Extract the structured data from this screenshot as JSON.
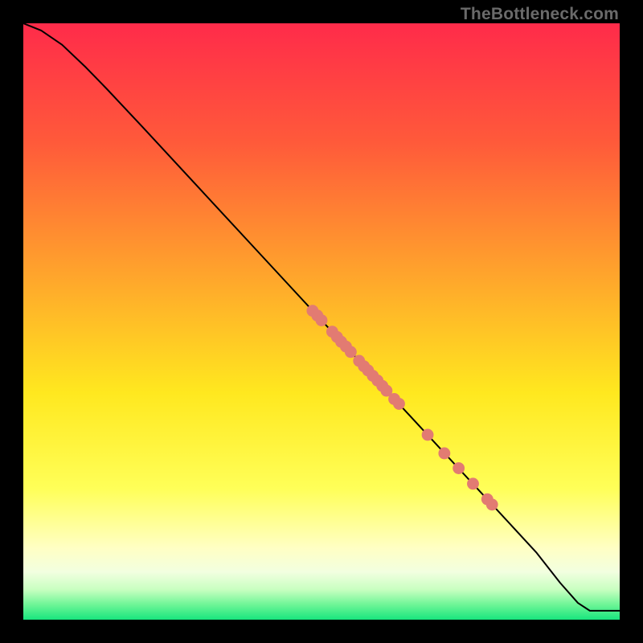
{
  "watermark": "TheBottleneck.com",
  "chart_data": {
    "type": "line",
    "title": "",
    "xlabel": "",
    "ylabel": "",
    "xlim": [
      0,
      100
    ],
    "ylim": [
      0,
      100
    ],
    "grid": false,
    "legend": false,
    "background_gradient": {
      "stops": [
        {
          "offset": 0.0,
          "color": "#ff2b4a"
        },
        {
          "offset": 0.2,
          "color": "#ff5a3a"
        },
        {
          "offset": 0.45,
          "color": "#ffae2a"
        },
        {
          "offset": 0.62,
          "color": "#ffe81f"
        },
        {
          "offset": 0.78,
          "color": "#ffff58"
        },
        {
          "offset": 0.88,
          "color": "#ffffc4"
        },
        {
          "offset": 0.92,
          "color": "#f2ffe0"
        },
        {
          "offset": 0.95,
          "color": "#c7ffc0"
        },
        {
          "offset": 0.975,
          "color": "#6df596"
        },
        {
          "offset": 1.0,
          "color": "#18e57e"
        }
      ]
    },
    "curve": [
      {
        "x": 0.0,
        "y": 100.0
      },
      {
        "x": 3.0,
        "y": 98.8
      },
      {
        "x": 6.5,
        "y": 96.4
      },
      {
        "x": 10.5,
        "y": 92.6
      },
      {
        "x": 14.0,
        "y": 89.0
      },
      {
        "x": 20.0,
        "y": 82.6
      },
      {
        "x": 30.0,
        "y": 71.8
      },
      {
        "x": 40.0,
        "y": 61.0
      },
      {
        "x": 50.0,
        "y": 50.2
      },
      {
        "x": 60.0,
        "y": 39.4
      },
      {
        "x": 70.0,
        "y": 28.6
      },
      {
        "x": 80.0,
        "y": 17.8
      },
      {
        "x": 86.0,
        "y": 11.3
      },
      {
        "x": 90.0,
        "y": 6.2
      },
      {
        "x": 93.0,
        "y": 2.8
      },
      {
        "x": 95.0,
        "y": 1.5
      },
      {
        "x": 100.0,
        "y": 1.5
      }
    ],
    "scatter": {
      "color": "#e27b72",
      "radius": 1.0,
      "points": [
        {
          "x": 48.5,
          "y": 51.8
        },
        {
          "x": 49.3,
          "y": 51.0
        },
        {
          "x": 50.0,
          "y": 50.2
        },
        {
          "x": 51.8,
          "y": 48.3
        },
        {
          "x": 52.6,
          "y": 47.4
        },
        {
          "x": 53.3,
          "y": 46.6
        },
        {
          "x": 54.1,
          "y": 45.8
        },
        {
          "x": 54.9,
          "y": 44.9
        },
        {
          "x": 56.3,
          "y": 43.4
        },
        {
          "x": 57.1,
          "y": 42.5
        },
        {
          "x": 57.8,
          "y": 41.8
        },
        {
          "x": 58.6,
          "y": 40.9
        },
        {
          "x": 59.4,
          "y": 40.1
        },
        {
          "x": 60.2,
          "y": 39.2
        },
        {
          "x": 60.9,
          "y": 38.4
        },
        {
          "x": 62.2,
          "y": 37.0
        },
        {
          "x": 63.0,
          "y": 36.2
        },
        {
          "x": 67.8,
          "y": 31.0
        },
        {
          "x": 70.6,
          "y": 27.9
        },
        {
          "x": 73.0,
          "y": 25.4
        },
        {
          "x": 75.4,
          "y": 22.8
        },
        {
          "x": 77.8,
          "y": 20.2
        },
        {
          "x": 78.6,
          "y": 19.3
        }
      ]
    }
  }
}
